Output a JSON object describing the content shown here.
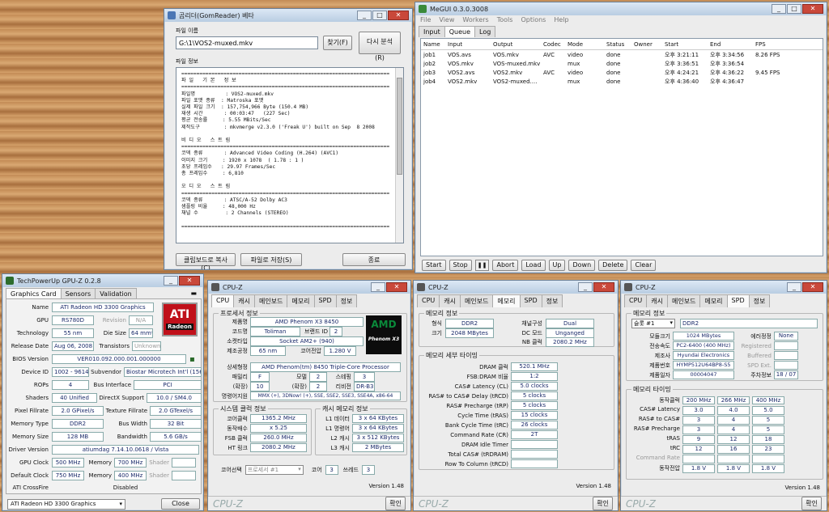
{
  "gomreader": {
    "title": "곰리더(GomReader) 베타",
    "file_label": "파일 이름",
    "file_value": "G:\\1\\VOS2-muxed.mkv",
    "find_btn": "찾기(F)",
    "reanalyze_btn": "다시 분석(R)",
    "info_label": "파일 정보",
    "info_lines": [
      "=====================================================================",
      "파 일   기 본   정 보",
      "=====================================================================",
      "파일명          : VOS2-muxed.mkv",
      "파일 포맷 종류  : Matroska 포맷",
      "실제 파일 크기  : 157,754,966 Byte (150.4 MB)",
      "재생 시간       : 00:03:47   (227 Sec)",
      "평균 전송률     : 5.55 MBits/Sec",
      "제작도구        : mkvmerge v2.3.0 ('Freak U') built on Sep  8 2008",
      "",
      "비 디 오   스 트 림",
      "=====================================================================",
      "코덱 종류       : Advanced Video Coding (H.264) (AVC1)",
      "이미지 크기     : 1920 x 1078  ( 1.78 : 1 )",
      "초당 프레임수   : 29.97 Frames/Sec",
      "총 프레임수     : 6,810",
      "",
      "오 디 오   스 트 림",
      "=====================================================================",
      "코덱 종류       : ATSC/A-52 Dolby AC3",
      "샘플링 비율     : 48,000 Hz",
      "채널 수         : 2 Channels (STEREO)",
      "",
      "====================================================================="
    ],
    "copy_btn": "클립보드로 복사(C)",
    "save_btn": "파일로 저장(S)",
    "close_btn": "종료"
  },
  "megui": {
    "title": "MeGUI 0.3.0.3008",
    "menu": [
      "File",
      "View",
      "Workers",
      "Tools",
      "Options",
      "Help"
    ],
    "tabs": [
      "Input",
      "Queue",
      "Log"
    ],
    "columns": [
      "Name",
      "Input",
      "Output",
      "Codec",
      "Mode",
      "Status",
      "Owner",
      "Start",
      "End",
      "FPS"
    ],
    "jobs": [
      [
        "job1",
        "VOS.avs",
        "VOS.mkv",
        "AVC",
        "video",
        "done",
        "",
        "오후 3:21:11",
        "오후 3:34:56",
        "8.26 FPS"
      ],
      [
        "job2",
        "VOS.mkv",
        "VOS-muxed.mkv",
        "",
        "mux",
        "done",
        "",
        "오후 3:36:51",
        "오후 3:36:54",
        ""
      ],
      [
        "job3",
        "VOS2.avs",
        "VOS2.mkv",
        "AVC",
        "video",
        "done",
        "",
        "오후 4:24:21",
        "오후 4:36:22",
        "9.45 FPS"
      ],
      [
        "job4",
        "VOS2.mkv",
        "VOS2-muxed....",
        "",
        "mux",
        "done",
        "",
        "오후 4:36:40",
        "오후 4:36:47",
        ""
      ]
    ],
    "buttons": [
      "Start",
      "Stop",
      "Abort",
      "Load",
      "Up",
      "Down",
      "Delete",
      "Clear"
    ]
  },
  "gpuz": {
    "title": "TechPowerUp GPU-Z 0.2.8",
    "tabs": [
      "Graphics Card",
      "Sensors",
      "Validation"
    ],
    "name": "ATI Radeon HD 3300 Graphics",
    "gpu": "RS780D",
    "revision": "N/A",
    "technology": "55 nm",
    "die_size": "64 mm²",
    "release_date": "Aug 06, 2008",
    "transistors": "Unknown",
    "bios": "VER010.092.000.001.000000",
    "device_id": "1002 - 9614",
    "subvendor": "Biostar Microtech Int'l (1565)",
    "rops": "4",
    "bus": "PCI",
    "shaders": "40 Unified",
    "directx": "10.0 / SM4.0",
    "pixel_fill": "2.0 GPixel/s",
    "texture_fill": "2.0 GTexel/s",
    "mem_type": "DDR2",
    "bus_width": "32 Bit",
    "mem_size": "128 MB",
    "bandwidth": "5.6 GB/s",
    "driver": "atiumdag 7.14.10.0618  / Vista",
    "gpu_clock": "500 MHz",
    "memory_clock": "700 MHz",
    "shader_clock": "",
    "default_clock": "750 MHz",
    "default_memory": "400 MHz",
    "default_shader": "",
    "crossfire": "Disabled",
    "footer_select": "ATI Radeon HD 3300 Graphics",
    "close": "Close",
    "labels": {
      "name": "Name",
      "gpu": "GPU",
      "revision": "Revision",
      "technology": "Technology",
      "die": "Die Size",
      "release": "Release Date",
      "transistors": "Transistors",
      "bios": "BIOS Version",
      "device": "Device ID",
      "subvendor": "Subvendor",
      "rops": "ROPs",
      "bus": "Bus Interface",
      "shaders": "Shaders",
      "directx": "DirectX Support",
      "pixel": "Pixel Fillrate",
      "texture": "Texture Fillrate",
      "memtype": "Memory Type",
      "buswidth": "Bus Width",
      "memsize": "Memory Size",
      "bandwidth": "Bandwidth",
      "driver": "Driver Version",
      "gpuclock": "GPU Clock",
      "memory": "Memory",
      "shader": "Shader",
      "defclock": "Default Clock",
      "crossfire": "ATI CrossFire"
    },
    "logo_top": "ATI",
    "logo_bottom": "Radeon"
  },
  "cpuz1": {
    "title": "CPU-Z",
    "tabs": [
      "CPU",
      "캐시",
      "메인보드",
      "메모리",
      "SPD",
      "정보"
    ],
    "proc_group": "프로세서 정보",
    "labels": {
      "name": "제품명",
      "code": "코드명",
      "brand": "브랜드 ID",
      "socket": "소켓타입",
      "process": "제조공정",
      "voltage": "코어전압",
      "spec": "상세형정",
      "family": "패밀리",
      "model": "모델",
      "stepping": "스테핑",
      "ext": "(확장)",
      "ext2": "(확장)",
      "rev": "리비전",
      "inst": "명령어지원"
    },
    "name": "AMD Phenom X3 8450",
    "code": "Toliman",
    "brand": "2",
    "socket": "Socket AM2+ (940)",
    "process": "65 nm",
    "voltage": "1.280 V",
    "spec": "AMD Phenom(tm) 8450 Triple-Core Processor",
    "family": "F",
    "model": "2",
    "stepping": "3",
    "ext_family": "10",
    "ext_model": "2",
    "revision": "DR-B3",
    "instructions": "MMX (+), 3DNow! (+), SSE, SSE2, SSE3, SSE4A, x86-64",
    "clock_group": "시스템 클럭 정보",
    "cl_labels": [
      "코어클럭",
      "동작배수",
      "FSB 클럭",
      "HT 링크"
    ],
    "clocks": [
      "1365.2 MHz",
      "x 5.25",
      "260.0 MHz",
      "2080.2 MHz"
    ],
    "cache_group": "캐시 메모리 정보",
    "ca_labels": [
      "L1 데이터",
      "L1 명령어",
      "L2 캐시",
      "L3 캐시"
    ],
    "cache": [
      "3 x 64 KBytes",
      "3 x 64 KBytes",
      "3 x 512 KBytes",
      "2 MBytes"
    ],
    "core_select_label": "코어선택",
    "core_select": "프로세서 #1",
    "cores_label": "코어",
    "cores": "3",
    "threads_label": "쓰레드",
    "threads": "3",
    "version": "Version 1.48",
    "brand_footer": "CPU-Z",
    "ok": "확인",
    "logo_text": "Phenom X3"
  },
  "cpuz2": {
    "title": "CPU-Z",
    "tabs": [
      "CPU",
      "캐시",
      "메인보드",
      "메모리",
      "SPD",
      "정보"
    ],
    "mem_group": "메모리 정보",
    "type_label": "형식",
    "type": "DDR2",
    "size_label": "크기",
    "size": "2048 MBytes",
    "channel_label": "채널구성",
    "channel": "Dual",
    "dc_label": "DC 모드",
    "dc": "Unganged",
    "nb_label": "NB 클럭",
    "nb": "2080.2 MHz",
    "timing_group": "메모리 세부 타이밍",
    "t_labels": [
      "DRAM 클럭",
      "FSB:DRAM 비율",
      "CAS# Latency (CL)",
      "RAS# to CAS# Delay (tRCD)",
      "RAS# Precharge (tRP)",
      "Cycle Time (tRAS)",
      "Bank Cycle Time (tRC)",
      "Command Rate (CR)",
      "DRAM Idle Timer",
      "Total CAS# (tRDRAM)",
      "Row To Column (tRCD)"
    ],
    "t_values": [
      "520.1 MHz",
      "1:2",
      "5.0 clocks",
      "5 clocks",
      "5 clocks",
      "15 clocks",
      "26 clocks",
      "2T",
      "",
      "",
      ""
    ],
    "version": "Version 1.48",
    "brand_footer": "CPU-Z",
    "ok": "확인"
  },
  "cpuz3": {
    "title": "CPU-Z",
    "tabs": [
      "CPU",
      "캐시",
      "메인보드",
      "메모리",
      "SPD",
      "정보"
    ],
    "slot_group": "메모리 정보",
    "slot": "슬롯 #1",
    "slot_type": "DDR2",
    "s_labels": [
      "모듈크기",
      "전송속도",
      "제조사",
      "제품번호",
      "제품일자"
    ],
    "s_values": [
      "1024 MBytes",
      "PC2-6400 (400 MHz)",
      "Hyundai Electronics",
      "HYMP512U64BP8-S5",
      "00004047"
    ],
    "r_labels": [
      "에러정정",
      "Registered",
      "Buffered",
      "SPD Ext.",
      "주차정보"
    ],
    "r_values": [
      "None",
      "",
      "",
      "",
      "18 / 07"
    ],
    "timing_group": "메모리 타이밍",
    "freq_label": "동작클럭",
    "freqs": [
      "200 MHz",
      "266 MHz",
      "400 MHz"
    ],
    "rows": [
      [
        "CAS# Latency",
        "3.0",
        "4.0",
        "5.0"
      ],
      [
        "RAS# to CAS#",
        "3",
        "4",
        "5"
      ],
      [
        "RAS# Precharge",
        "3",
        "4",
        "5"
      ],
      [
        "tRAS",
        "9",
        "12",
        "18"
      ],
      [
        "tRC",
        "12",
        "16",
        "23"
      ],
      [
        "Command Rate",
        "",
        "",
        ""
      ],
      [
        "동작전압",
        "1.8 V",
        "1.8 V",
        "1.8 V"
      ]
    ],
    "version": "Version 1.48",
    "brand_footer": "CPU-Z",
    "ok": "확인"
  }
}
